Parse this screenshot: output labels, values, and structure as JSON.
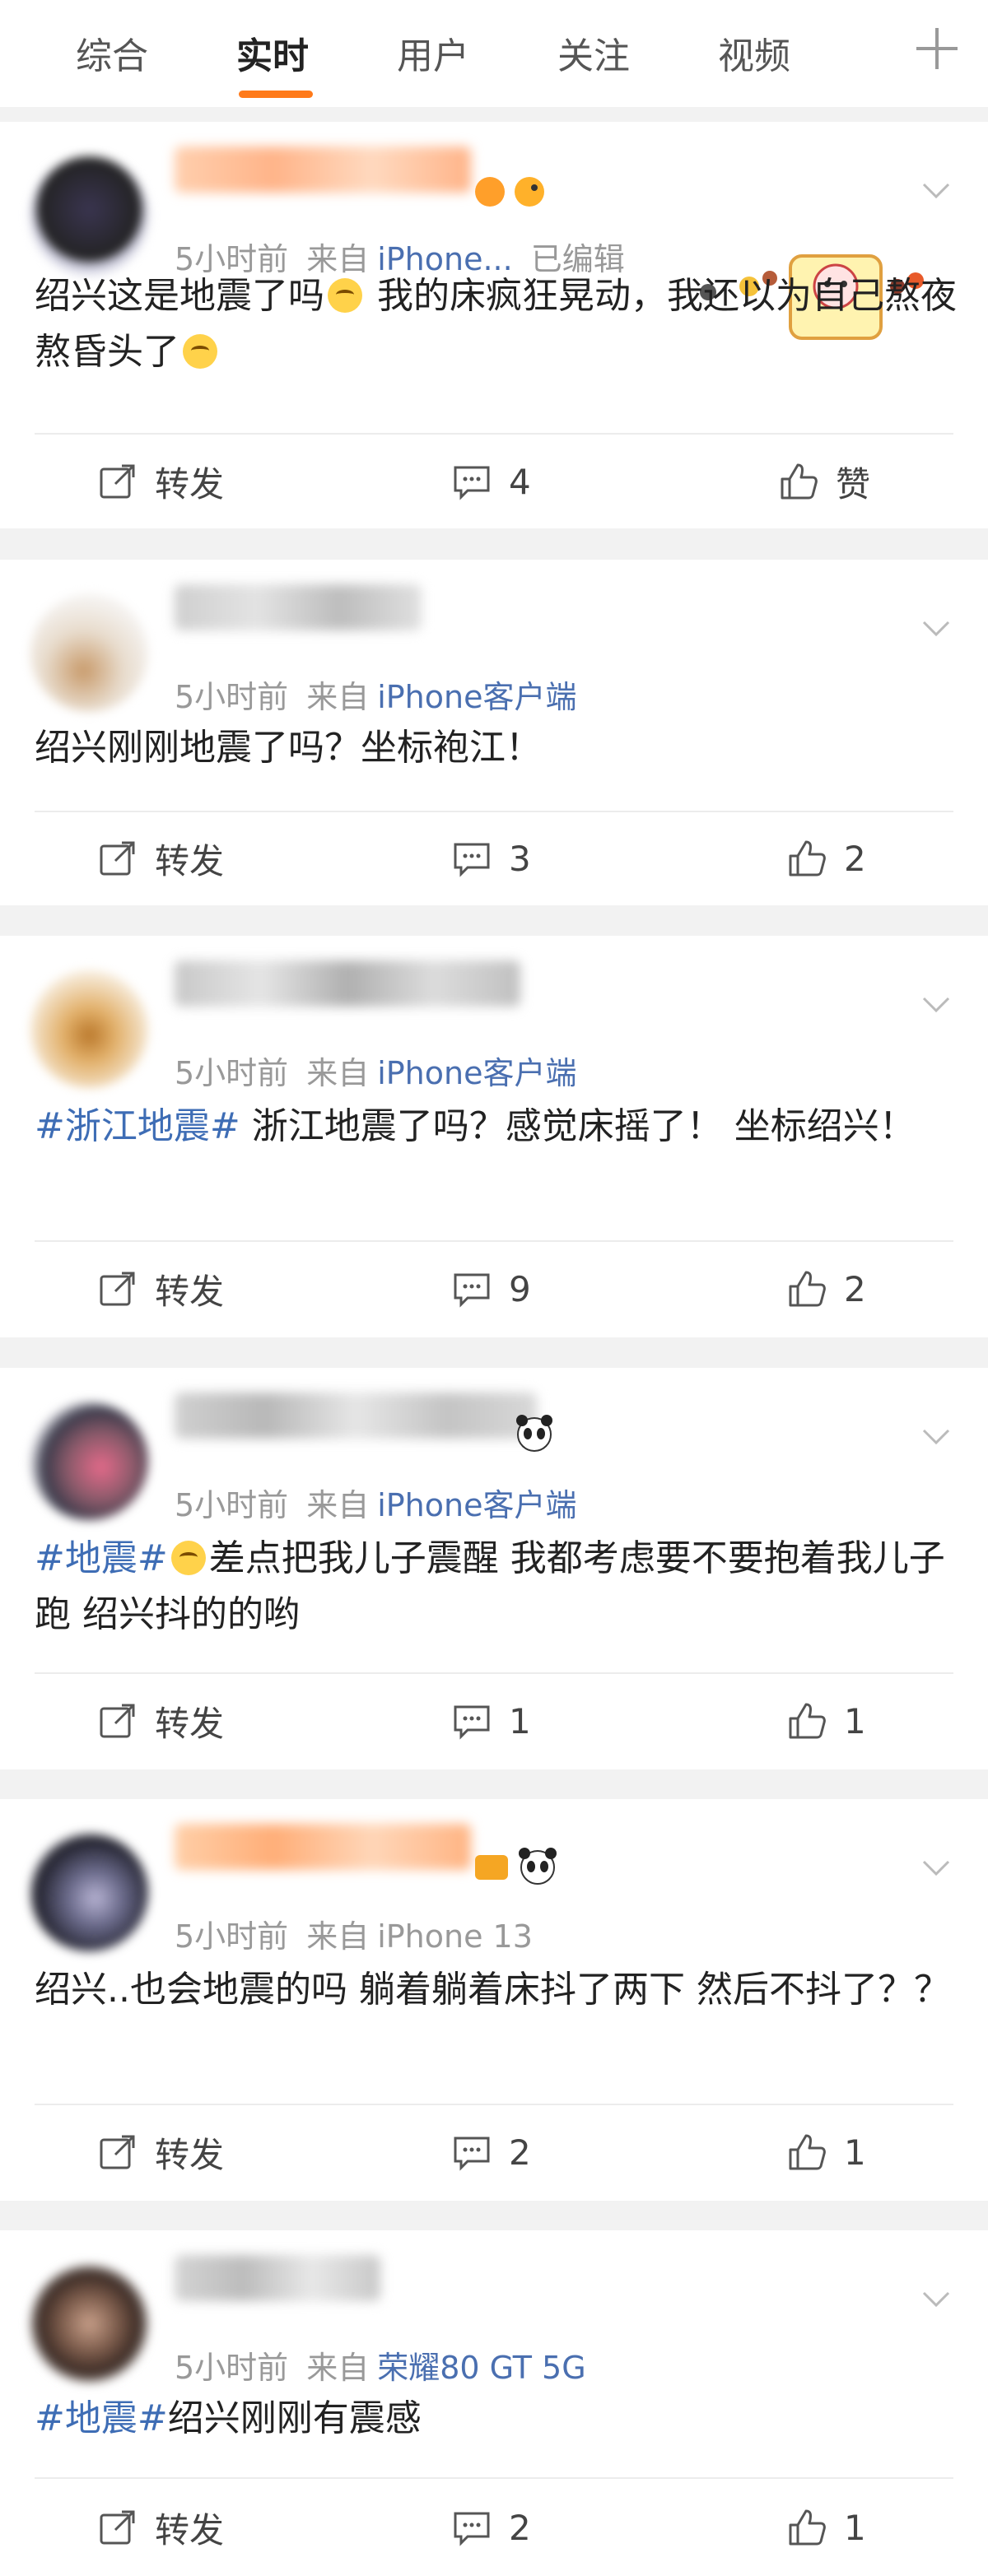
{
  "tabs": [
    {
      "label": "综合"
    },
    {
      "label": "实时"
    },
    {
      "label": "用户"
    },
    {
      "label": "关注"
    },
    {
      "label": "视频"
    }
  ],
  "labels": {
    "repost": "转发",
    "like": "赞",
    "from": "来自",
    "edited": "已编辑"
  },
  "posts": [
    {
      "time": "5小时前",
      "source": "iPhone...",
      "text_before": "绍兴这是地震了吗",
      "text_after": "我的床疯狂晃动，我还以为自己熬夜熬昏头了",
      "comments": "4",
      "likes": "赞"
    },
    {
      "time": "5小时前",
      "source": "iPhone客户端",
      "text": "绍兴刚刚地震了吗？坐标袍江！",
      "comments": "3",
      "likes": "2"
    },
    {
      "time": "5小时前",
      "source": "iPhone客户端",
      "tag": "#浙江地震#",
      "text": " 浙江地震了吗？感觉床摇了！ 坐标绍兴！",
      "comments": "9",
      "likes": "2"
    },
    {
      "time": "5小时前",
      "source": "iPhone客户端",
      "tag": "#地震#",
      "text": "差点把我儿子震醒 我都考虑要不要抱着我儿子跑 绍兴抖的的哟",
      "comments": "1",
      "likes": "1"
    },
    {
      "time": "5小时前",
      "source": "iPhone 13",
      "text": "绍兴..也会地震的吗 躺着躺着床抖了两下 然后不抖了？？",
      "comments": "2",
      "likes": "1"
    },
    {
      "time": "5小时前",
      "source": "荣耀80 GT 5G",
      "tag": "#地震#",
      "text": "绍兴刚刚有震感",
      "comments": "2",
      "likes": "1"
    }
  ],
  "colors": {
    "accent": "#ff7a1a",
    "link": "#3e6db5",
    "muted": "#999999"
  },
  "icons": [
    "plus-icon",
    "chevron-down-icon",
    "repost-icon",
    "comment-icon",
    "like-icon"
  ]
}
